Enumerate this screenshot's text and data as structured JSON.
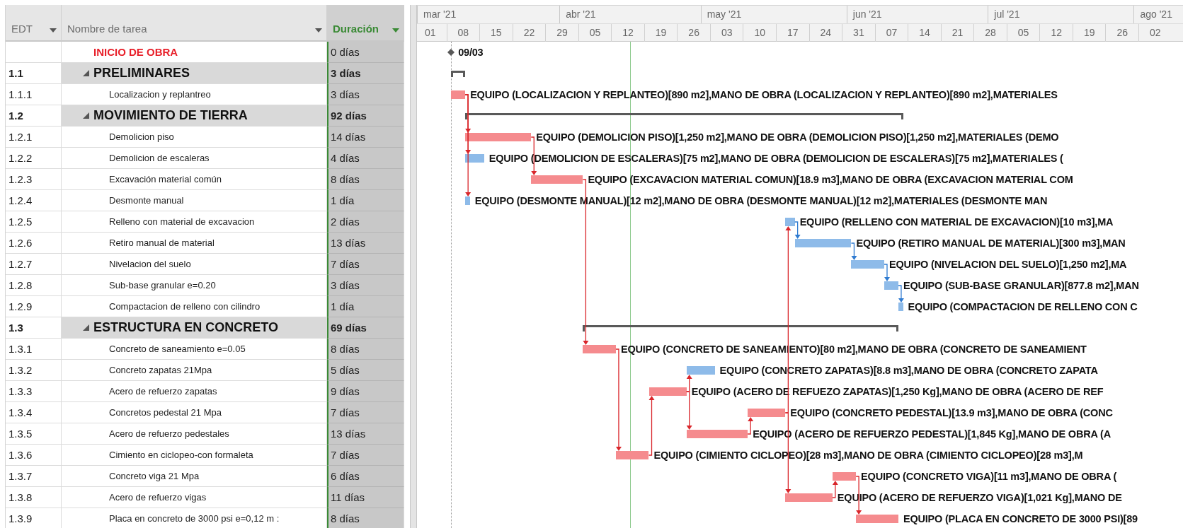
{
  "table": {
    "columns": [
      {
        "label": "EDT",
        "selected": false
      },
      {
        "label": "Nombre de tarea",
        "selected": false
      },
      {
        "label": "Duración",
        "selected": true
      }
    ]
  },
  "timescale": {
    "months": [
      "mar '21",
      "abr '21",
      "may '21",
      "jun '21",
      "jul '21",
      "ago '21"
    ],
    "weeks": [
      "01",
      "08",
      "15",
      "22",
      "29",
      "05",
      "12",
      "19",
      "26",
      "03",
      "10",
      "17",
      "24",
      "31",
      "07",
      "14",
      "21",
      "28",
      "05",
      "12",
      "19",
      "26",
      "02"
    ]
  },
  "tasks": [
    {
      "kind": "milestone",
      "name": "INICIO DE OBRA",
      "duration": "0 días",
      "bar_label": "09/03"
    },
    {
      "kind": "summary",
      "edt": "1.1",
      "name": "PRELIMINARES",
      "duration": "3 días",
      "expanded": true,
      "children": [
        {
          "kind": "task",
          "edt": "1.1.1",
          "name": "Localizacion y replantreo",
          "duration": "3 días",
          "critical": true,
          "bar_label": "EQUIPO (LOCALIZACION Y REPLANTEO)[890 m2],MANO DE OBRA (LOCALIZACION Y REPLANTEO)[890 m2],MATERIALES"
        }
      ]
    },
    {
      "kind": "summary",
      "edt": "1.2",
      "name": "MOVIMIENTO DE TIERRA",
      "duration": "92 días",
      "expanded": true,
      "children": [
        {
          "kind": "task",
          "edt": "1.2.1",
          "name": "Demolicion piso",
          "duration": "14 días",
          "critical": true,
          "bar_label": "EQUIPO (DEMOLICION PISO)[1,250 m2],MANO DE OBRA (DEMOLICION PISO)[1,250 m2],MATERIALES (DEMO"
        },
        {
          "kind": "task",
          "edt": "1.2.2",
          "name": "Demolicion de escaleras",
          "duration": "4 días",
          "critical": false,
          "bar_label": "EQUIPO (DEMOLICION DE ESCALERAS)[75 m2],MANO DE OBRA (DEMOLICION DE ESCALERAS)[75 m2],MATERIALES ("
        },
        {
          "kind": "task",
          "edt": "1.2.3",
          "name": "Excavación material común",
          "duration": "8 días",
          "critical": true,
          "bar_label": "EQUIPO (EXCAVACION MATERIAL COMUN)[18.9 m3],MANO DE OBRA (EXCAVACION MATERIAL COM"
        },
        {
          "kind": "task",
          "edt": "1.2.4",
          "name": "Desmonte manual",
          "duration": "1 día",
          "critical": false,
          "bar_label": "EQUIPO (DESMONTE MANUAL)[12 m2],MANO DE OBRA (DESMONTE MANUAL)[12 m2],MATERIALES (DESMONTE MAN"
        },
        {
          "kind": "task",
          "edt": "1.2.5",
          "name": "Relleno con material de excavacion",
          "duration": "2 días",
          "critical": false,
          "bar_label": "EQUIPO (RELLENO CON MATERIAL DE EXCAVACION)[10 m3],MA"
        },
        {
          "kind": "task",
          "edt": "1.2.6",
          "name": "Retiro manual de material",
          "duration": "13 días",
          "critical": false,
          "bar_label": "EQUIPO (RETIRO MANUAL DE MATERIAL)[300 m3],MAN"
        },
        {
          "kind": "task",
          "edt": "1.2.7",
          "name": "Nivelacion del suelo",
          "duration": "7 días",
          "critical": false,
          "bar_label": "EQUIPO (NIVELACION DEL SUELO)[1,250 m2],MA"
        },
        {
          "kind": "task",
          "edt": "1.2.8",
          "name": "Sub-base granular e=0.20",
          "duration": "3 días",
          "critical": false,
          "bar_label": "EQUIPO (SUB-BASE GRANULAR)[877.8 m2],MAN"
        },
        {
          "kind": "task",
          "edt": "1.2.9",
          "name": "Compactacion de relleno con cilindro",
          "duration": "1 día",
          "critical": false,
          "bar_label": "EQUIPO (COMPACTACION DE RELLENO CON C"
        }
      ]
    },
    {
      "kind": "summary",
      "edt": "1.3",
      "name": "ESTRUCTURA EN CONCRETO",
      "duration": "69 días",
      "expanded": true,
      "children": [
        {
          "kind": "task",
          "edt": "1.3.1",
          "name": "Concreto de saneamiento e=0.05",
          "duration": "8 días",
          "critical": true,
          "bar_label": "EQUIPO (CONCRETO DE SANEAMIENTO)[80 m2],MANO DE OBRA (CONCRETO DE SANEAMIENT"
        },
        {
          "kind": "task",
          "edt": "1.3.2",
          "name": "Concreto zapatas 21Mpa",
          "duration": "5 días",
          "critical": false,
          "bar_label": "EQUIPO (CONCRETO ZAPATAS)[8.8 m3],MANO DE OBRA (CONCRETO ZAPATA"
        },
        {
          "kind": "task",
          "edt": "1.3.3",
          "name": "Acero de refuerzo zapatas",
          "duration": "9 días",
          "critical": true,
          "bar_label": "EQUIPO (ACERO DE REFUEZO ZAPATAS)[1,250 Kg],MANO DE OBRA (ACERO DE REF"
        },
        {
          "kind": "task",
          "edt": "1.3.4",
          "name": "Concretos pedestal 21 Mpa",
          "duration": "7 días",
          "critical": true,
          "bar_label": "EQUIPO (CONCRETO PEDESTAL)[13.9 m3],MANO DE OBRA (CONC"
        },
        {
          "kind": "task",
          "edt": "1.3.5",
          "name": "Acero de refuerzo pedestales",
          "duration": "13 días",
          "critical": true,
          "bar_label": "EQUIPO (ACERO DE REFUERZO PEDESTAL)[1,845 Kg],MANO DE OBRA (A"
        },
        {
          "kind": "task",
          "edt": "1.3.6",
          "name": "Cimiento en ciclopeo-con formaleta",
          "duration": "7 días",
          "critical": true,
          "bar_label": "EQUIPO (CIMIENTO CICLOPEO)[28 m3],MANO DE OBRA (CIMIENTO CICLOPEO)[28 m3],M"
        },
        {
          "kind": "task",
          "edt": "1.3.7",
          "name": "Concreto viga 21 Mpa",
          "duration": "6 días",
          "critical": true,
          "bar_label": "EQUIPO (CONCRETO VIGA)[11 m3],MANO DE OBRA ("
        },
        {
          "kind": "task",
          "edt": "1.3.8",
          "name": "Acero de refuerzo vigas",
          "duration": "11 días",
          "critical": true,
          "bar_label": "EQUIPO (ACERO DE REFUERZO VIGA)[1,021 Kg],MANO DE"
        },
        {
          "kind": "task",
          "edt": "1.3.9",
          "name": "Placa en concreto de 3000 psi e=0,12 m :",
          "duration": "8 días",
          "critical": true,
          "bar_label": "EQUIPO (PLACA EN CONCRETO DE 3000 PSI)[89"
        }
      ]
    }
  ]
}
